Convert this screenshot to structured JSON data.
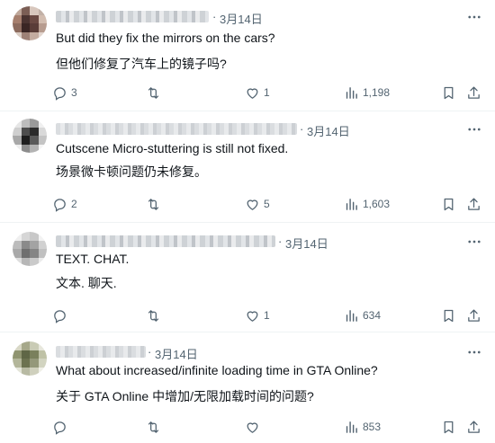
{
  "replies": [
    {
      "date": "3月14日",
      "text_en": "But did they fix the mirrors on the cars?",
      "text_zh": "但他们修复了汽车上的镜子吗?",
      "replies": "3",
      "retweets": "",
      "likes": "1",
      "views": "1,198"
    },
    {
      "date": "3月14日",
      "text_en": "Cutscene Micro-stuttering is still not fixed.",
      "text_zh": "场景微卡顿问题仍未修复。",
      "replies": "2",
      "retweets": "",
      "likes": "5",
      "views": "1,603"
    },
    {
      "date": "3月14日",
      "text_en": "TEXT. CHAT.",
      "text_zh": "文本. 聊天.",
      "replies": "",
      "retweets": "",
      "likes": "1",
      "views": "634"
    },
    {
      "date": "3月14日",
      "text_en": "What about increased/infinite loading time in GTA Online?",
      "text_zh": "关于 GTA Online 中增加/无限加载时间的问题?",
      "replies": "",
      "retweets": "",
      "likes": "",
      "views": "853"
    }
  ],
  "icons": {
    "reply": "reply-icon",
    "retweet": "retweet-icon",
    "like": "like-icon",
    "views": "views-icon",
    "bookmark": "bookmark-icon",
    "share": "share-icon",
    "more": "more-icon"
  },
  "colors": {
    "text": "#0f1419",
    "muted": "#536471",
    "divider": "#eff3f4"
  }
}
